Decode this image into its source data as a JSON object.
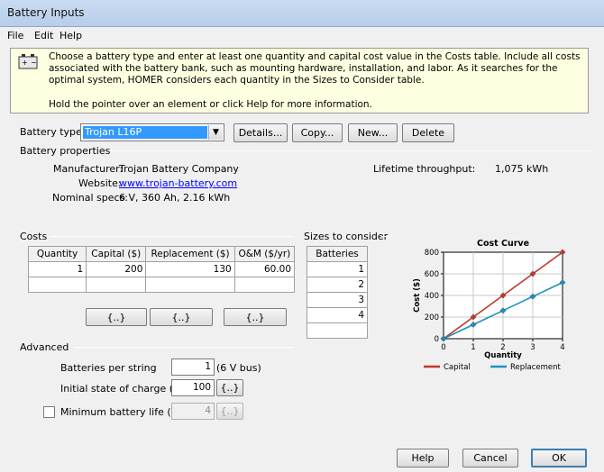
{
  "window": {
    "title": "Battery Inputs"
  },
  "menu": {
    "file": "File",
    "edit": "Edit",
    "help": "Help"
  },
  "help_box": {
    "text": "Choose a battery type and enter at least one quantity and capital cost value in the Costs table. Include all costs associated with the battery bank, such as mounting hardware, installation, and labor. As it searches for the optimal system, HOMER considers each quantity in the Sizes to Consider table.",
    "hint": "Hold the pointer over an element or click Help for more information."
  },
  "battery_type": {
    "label": "Battery type",
    "selected": "Trojan L16P",
    "buttons": {
      "details": "Details...",
      "copy": "Copy...",
      "new": "New...",
      "delete": "Delete"
    }
  },
  "properties": {
    "title": "Battery properties",
    "manufacturer_label": "Manufacturer:",
    "manufacturer": "Trojan Battery Company",
    "website_label": "Website:",
    "website": "www.trojan-battery.com",
    "nominal_label": "Nominal specs:",
    "nominal": "6 V, 360 Ah, 2.16 kWh",
    "lifetime_label": "Lifetime throughput:",
    "lifetime": "1,075 kWh"
  },
  "costs": {
    "title": "Costs",
    "headers": [
      "Quantity",
      "Capital ($)",
      "Replacement ($)",
      "O&M ($/yr)"
    ],
    "rows": [
      [
        "1",
        "200",
        "130",
        "60.00"
      ]
    ],
    "edit_buttons": [
      "{..}",
      "{..}",
      "{..}"
    ]
  },
  "sizes": {
    "title": "Sizes to consider",
    "header": "Batteries",
    "values": [
      "1",
      "2",
      "3",
      "4"
    ]
  },
  "advanced": {
    "title": "Advanced",
    "per_string_label": "Batteries per string",
    "per_string_value": "1",
    "per_string_unit": "(6 V bus)",
    "soc_label": "Initial state of charge (%)",
    "soc_value": "100",
    "soc_button": "{..}",
    "min_life_label": "Minimum battery life (yr)",
    "min_life_value": "4",
    "min_life_button": "{..}",
    "min_life_checked": false
  },
  "footer": {
    "help": "Help",
    "cancel": "Cancel",
    "ok": "OK"
  },
  "colors": {
    "capital": "#c0392b",
    "replacement": "#1f8fc0",
    "selection": "#3399ff"
  },
  "chart_data": {
    "type": "line",
    "title": "Cost Curve",
    "xlabel": "Quantity",
    "ylabel": "Cost ($)",
    "x": [
      0,
      1,
      2,
      3,
      4
    ],
    "xticks": [
      0,
      1,
      2,
      3,
      4
    ],
    "yticks": [
      0,
      200,
      400,
      600,
      800
    ],
    "xlim": [
      0,
      4
    ],
    "ylim": [
      0,
      800
    ],
    "grid": true,
    "legend": "bottom",
    "series": [
      {
        "name": "Capital",
        "values": [
          0,
          200,
          400,
          600,
          800
        ],
        "color": "#c0392b"
      },
      {
        "name": "Replacement",
        "values": [
          0,
          130,
          260,
          390,
          520
        ],
        "color": "#1f8fc0"
      }
    ]
  }
}
